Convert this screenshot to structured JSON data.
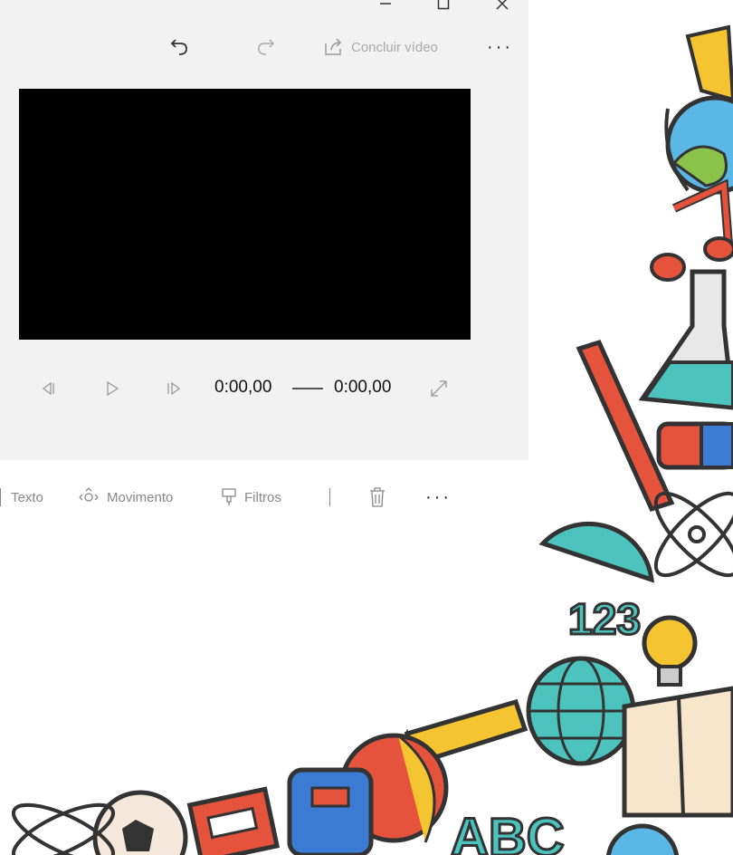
{
  "toolbar": {
    "finish_label": "Concluir vídeo",
    "more_label": "···"
  },
  "player": {
    "current_time": "0:00,00",
    "total_time": "0:00,00"
  },
  "edit_tools": {
    "text_label": "Texto",
    "motion_label": "Movimento",
    "filters_label": "Filtros",
    "more_label": "···"
  },
  "background": {
    "number_sticker": "123",
    "letters_sticker": "ABC"
  }
}
